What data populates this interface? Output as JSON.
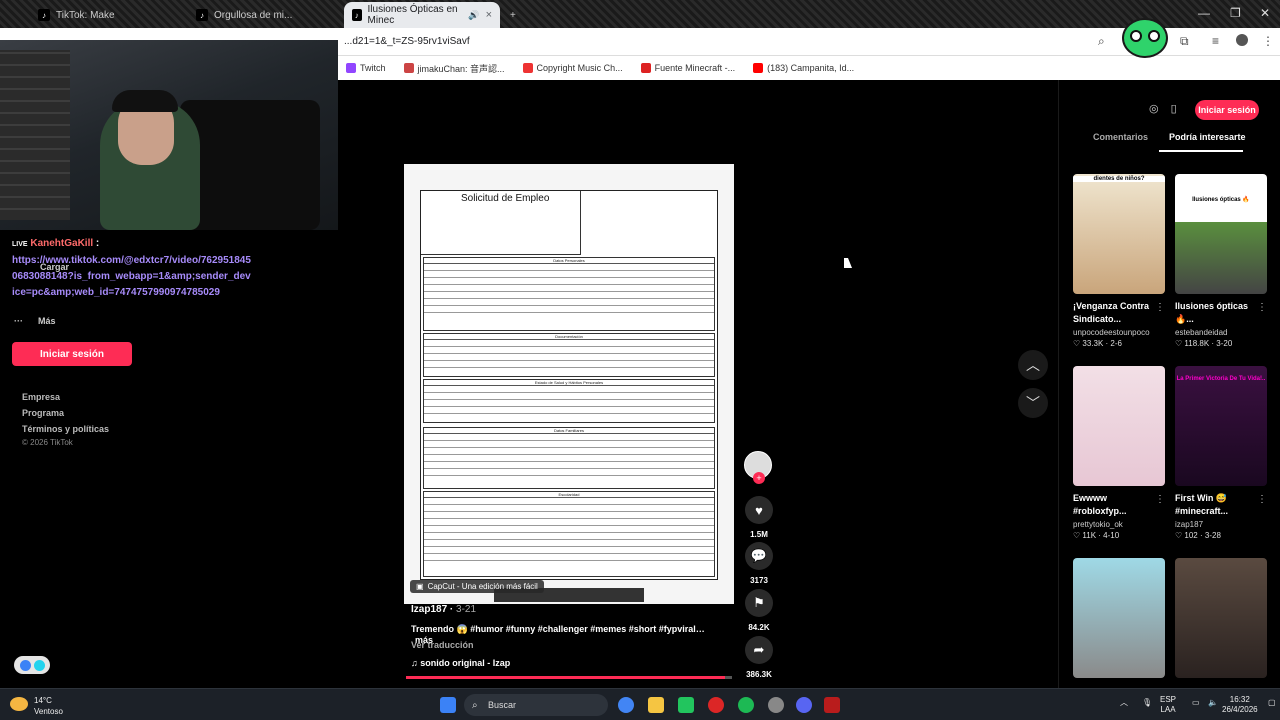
{
  "browser": {
    "tabs": [
      {
        "title": "TikTok: Make"
      },
      {
        "title": "Orgullosa de mi..."
      },
      {
        "title": "Ilusiones Ópticas en Minec"
      }
    ],
    "url": "...d21=1&_t=ZS-95rv1viSavf",
    "bookmarks": [
      "Twitch",
      "jimakuChan: 音声認...",
      "Copyright Music Ch...",
      "Fuente Minecraft -...",
      "(183) Campanita, Id..."
    ]
  },
  "stream_overlay": {
    "chat_user": "KanehtGaKill",
    "chat_message": "https://www.tiktok.com/@edxtcr7/video/7629518450683088148?is_from_webapp=1&amp;sender_device=pc&amp;web_id=7474757990974785029",
    "badge": "LIVE"
  },
  "left_nav": {
    "cargar": "Cargar",
    "mas": "Más",
    "login": "Iniciar sesión",
    "footer": [
      "Empresa",
      "Programa",
      "Términos y políticas"
    ],
    "copyright": "© 2026 TikTok"
  },
  "video": {
    "doc_title": "Solicitud de Empleo",
    "sections": [
      "Datos Personales",
      "Documentación",
      "Estado de Salud y Hábitos Personales",
      "Datos Familiares",
      "Escolaridad"
    ],
    "capcut": "CapCut - Una edición más fácil",
    "author": "Izap187",
    "date": "3-21",
    "caption": "Tremendo 😱 #humor #funny #challenger #memes #short #fypviral…",
    "more": "más",
    "translate": "Ver traducción",
    "sound": "sonido original - Izap",
    "progress": 0.98,
    "likes": "1.5M",
    "comments": "3173",
    "saves": "84.2K",
    "shares": "386.3K"
  },
  "right_panel": {
    "login": "Iniciar sesión",
    "tabs": [
      "Comentarios",
      "Podría interesarte"
    ],
    "cards": [
      {
        "title": "¡Venganza Contra Sindicato...",
        "author": "unpocodeestounpoco",
        "likes": "33.3K",
        "date": "2-6",
        "thumb_text": "dientes de niños?"
      },
      {
        "title": "Ilusiones ópticas 🔥...",
        "author": "estebandeidad",
        "likes": "118.8K",
        "date": "3-20",
        "thumb_text": "Ilusiones ópticas 🔥"
      },
      {
        "title": "Ewwww #robloxfyp...",
        "author": "prettytokio_ok",
        "likes": "11K",
        "date": "4-10",
        "thumb_text": ""
      },
      {
        "title": "First Win 😅 #minecraft...",
        "author": "izap187",
        "likes": "102",
        "date": "3-28",
        "thumb_text": "La Primer Victoria De Tu Vida!.."
      },
      {
        "title": "",
        "author": "",
        "likes": "",
        "date": "",
        "thumb_text": ""
      },
      {
        "title": "",
        "author": "",
        "likes": "",
        "date": "",
        "thumb_text": ""
      }
    ]
  },
  "taskbar": {
    "temp": "14°C",
    "weather": "Ventoso",
    "search": "Buscar",
    "lang": "ESP",
    "lang2": "LAA",
    "time": "16:32",
    "date": "26/4/2026"
  },
  "colors": {
    "accent": "#fe2c55",
    "chat_purple": "#a78bfa"
  }
}
